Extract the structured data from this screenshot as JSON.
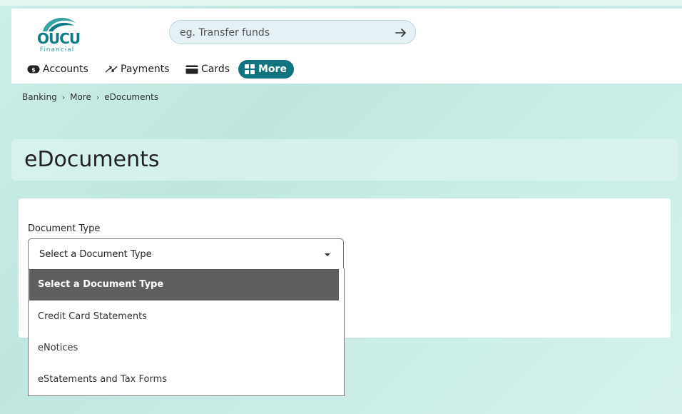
{
  "brand": {
    "logo_main": "OUCU",
    "logo_sub": "Financial",
    "color": "#0e7c86"
  },
  "search": {
    "placeholder": "eg. Transfer funds",
    "submit_icon": "arrow-right-icon"
  },
  "nav": {
    "items": [
      {
        "label": "Accounts",
        "icon": "dollar-pill-icon"
      },
      {
        "label": "Payments",
        "icon": "transfer-arrows-icon"
      },
      {
        "label": "Cards",
        "icon": "card-icon"
      },
      {
        "label": "More",
        "icon": "grid-icon",
        "active": true
      }
    ],
    "active_color": "#0d7480"
  },
  "breadcrumb": [
    "Banking",
    "More",
    "eDocuments"
  ],
  "page": {
    "title": "eDocuments"
  },
  "form": {
    "document_type": {
      "label": "Document Type",
      "selected": "Select a Document Type",
      "options": [
        "Select a Document Type",
        "Credit Card Statements",
        "eNotices",
        "eStatements and Tax Forms"
      ],
      "highlight_color": "#5f5f5f"
    }
  }
}
